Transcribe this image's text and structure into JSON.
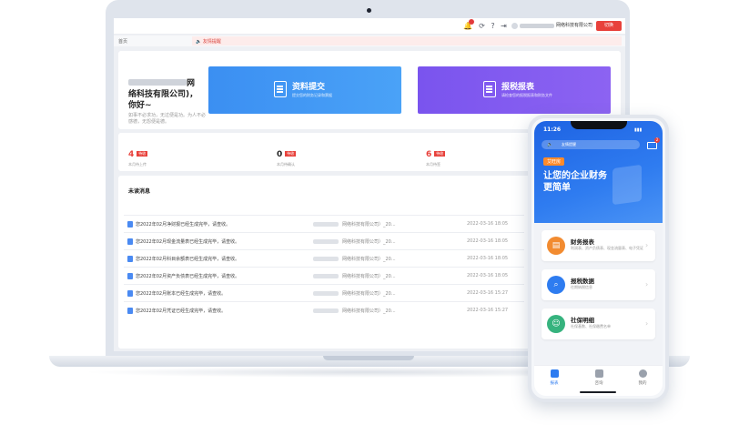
{
  "desktop": {
    "topbar": {
      "notification_count": "6",
      "company": "网络科技有限公司",
      "logout_label": "切换"
    },
    "tabs": {
      "home": "首页",
      "tip": "友情提醒"
    },
    "welcome": {
      "title_tail": "网络科技有限公司)，你好~",
      "subtitle": "如事不必求功，无过便是功。为人不必感德，无怨便是德。",
      "submit_btn": {
        "title": "资料提交",
        "sub": "提交您的财务记录和票据"
      },
      "tax_btn": {
        "title": "报税报表",
        "sub": "请检查您的报税报表和财务文件"
      }
    },
    "stats": [
      {
        "value": "4",
        "tag": "待收",
        "label": "本月待上传",
        "color": "#e8413b"
      },
      {
        "value": "0",
        "tag": "待收",
        "label": "本月待确认",
        "color": "#222222"
      },
      {
        "value": "6",
        "tag": "待收",
        "label": "本月待签",
        "color": "#e8413b"
      }
    ],
    "messages": {
      "title": "未读消息",
      "items": [
        {
          "text": "您2022年02月净财报已经生成完毕，请查收。",
          "company": "网络科技有限公司）_20...",
          "time": "2022-03-16 18:05"
        },
        {
          "text": "您2022年02月现金流量表已经生成完毕，请查收。",
          "company": "网络科技有限公司）_20...",
          "time": "2022-03-16 18:05"
        },
        {
          "text": "您2022年02月科目余额表已经生成完毕，请查收。",
          "company": "网络科技有限公司）_20...",
          "time": "2022-03-16 18:05"
        },
        {
          "text": "您2022年02月资产负债表已经生成完毕，请查收。",
          "company": "网络科技有限公司）_20...",
          "time": "2022-03-16 18:05"
        },
        {
          "text": "您2022年02月账本已经生成完毕，请查收。",
          "company": "网络科技有限公司）_20...",
          "time": "2022-03-16 15:27"
        },
        {
          "text": "您2022年02月凭证已经生成完毕，请查收。",
          "company": "网络科技有限公司）_20...",
          "time": "2022-03-16 15:27"
        }
      ]
    }
  },
  "mobile": {
    "time": "11:26",
    "search_text": "友情提醒",
    "mail_badge": "2",
    "hero_tag": "艾旺房",
    "hero_title_line1": "让您的企业财务",
    "hero_title_line2": "更简单",
    "cards": [
      {
        "title": "财务报表",
        "sub": "利润表、资产负债表、现金流量表、电子凭证",
        "color": "#f28b30",
        "icon": "document-icon"
      },
      {
        "title": "报税数据",
        "sub": "往期纳税信息",
        "color": "#2e7cf0",
        "icon": "search-icon"
      },
      {
        "title": "社保明细",
        "sub": "社保基数、社保缴费名单",
        "color": "#36b37e",
        "icon": "people-icon"
      }
    ],
    "tabbar": [
      {
        "label": "报表",
        "active": true
      },
      {
        "label": "咨询",
        "active": false
      },
      {
        "label": "我的",
        "active": false
      }
    ]
  }
}
